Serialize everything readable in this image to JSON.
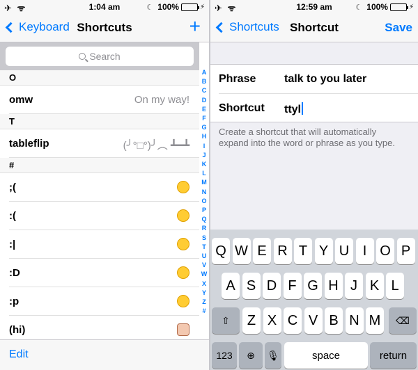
{
  "left": {
    "status": {
      "left_icons": "✈ ᯤ",
      "time": "1:04 am",
      "battery": "100%"
    },
    "nav": {
      "back_label": "Keyboard",
      "title": "Shortcuts",
      "add_label": "+"
    },
    "search": {
      "placeholder": "Search"
    },
    "sections": [
      {
        "header": "O",
        "rows": [
          {
            "phrase": "omw",
            "value": "On my way!",
            "emoji": ""
          }
        ]
      },
      {
        "header": "T",
        "rows": [
          {
            "phrase": "tableflip",
            "value": "(╯°□°)╯︵ ┻━┻",
            "emoji": ""
          }
        ]
      },
      {
        "header": "#",
        "rows": [
          {
            "phrase": ";(",
            "value": "",
            "emoji": "crying-face"
          },
          {
            "phrase": ":(",
            "value": "",
            "emoji": "sad-face"
          },
          {
            "phrase": ":|",
            "value": "",
            "emoji": "neutral-face"
          },
          {
            "phrase": ":D",
            "value": "",
            "emoji": "grinning-face"
          },
          {
            "phrase": ":p",
            "value": "",
            "emoji": "tongue-face"
          },
          {
            "phrase": "(hi)",
            "value": "",
            "emoji": "girl-face"
          }
        ]
      }
    ],
    "index_letters": [
      "A",
      "B",
      "C",
      "D",
      "E",
      "F",
      "G",
      "H",
      "I",
      "J",
      "K",
      "L",
      "M",
      "N",
      "O",
      "P",
      "Q",
      "R",
      "S",
      "T",
      "U",
      "V",
      "W",
      "X",
      "Y",
      "Z",
      "#"
    ],
    "toolbar": {
      "edit_label": "Edit"
    }
  },
  "right": {
    "status": {
      "left_icons": "✈ ᯤ",
      "time": "12:59 am",
      "battery": "100%"
    },
    "nav": {
      "back_label": "Shortcuts",
      "title": "Shortcut",
      "save_label": "Save"
    },
    "form": {
      "phrase_label": "Phrase",
      "phrase_value": "talk to you later",
      "shortcut_label": "Shortcut",
      "shortcut_value": "ttyl"
    },
    "hint": "Create a shortcut that will automatically expand into the word or phrase as you type.",
    "keyboard": {
      "row1": [
        "Q",
        "W",
        "E",
        "R",
        "T",
        "Y",
        "U",
        "I",
        "O",
        "P"
      ],
      "row2": [
        "A",
        "S",
        "D",
        "F",
        "G",
        "H",
        "J",
        "K",
        "L"
      ],
      "row3": [
        "Z",
        "X",
        "C",
        "V",
        "B",
        "N",
        "M"
      ],
      "numbers_label": "123",
      "space_label": "space",
      "return_label": "return"
    }
  }
}
